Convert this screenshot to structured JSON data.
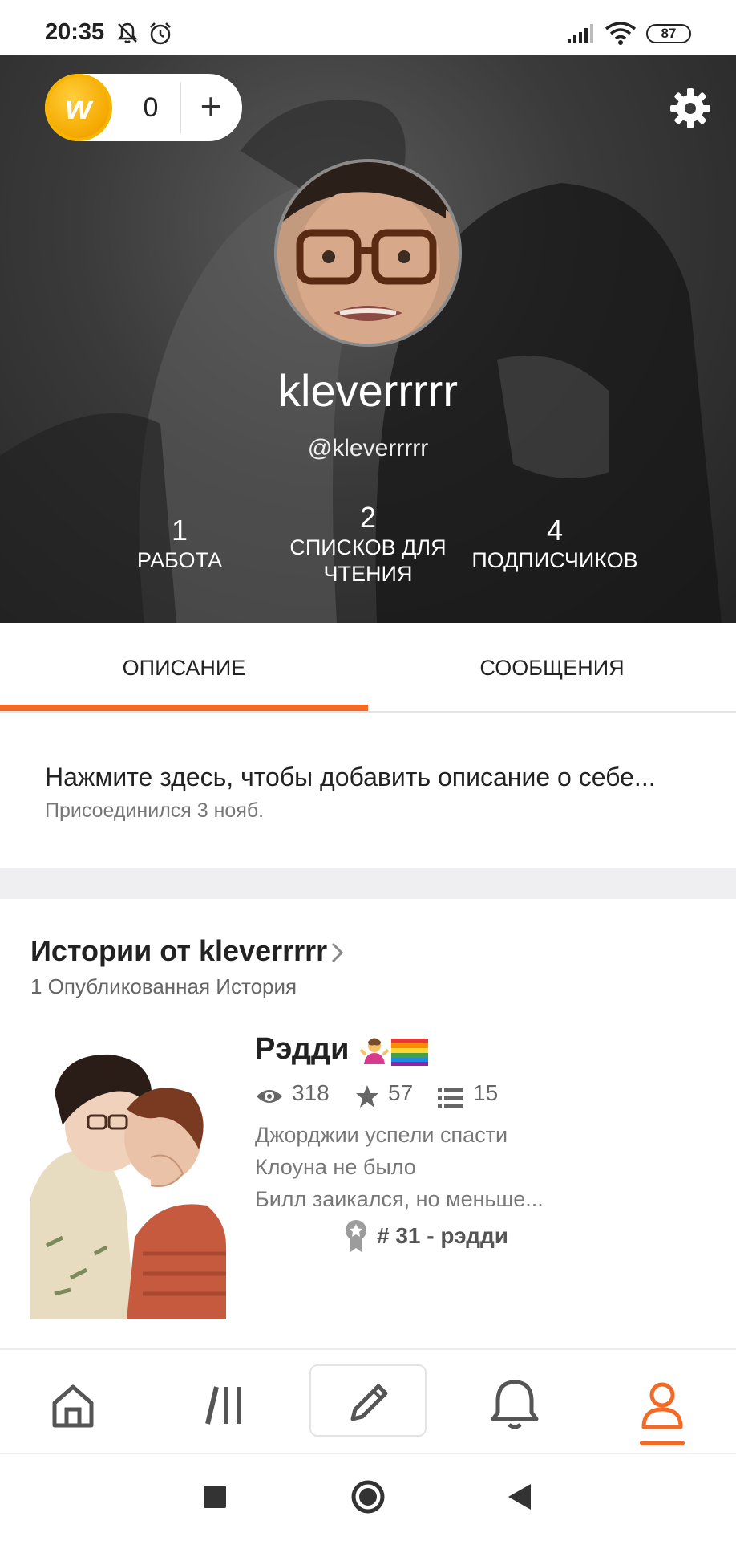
{
  "status_bar": {
    "time": "20:35",
    "battery": "87",
    "icons": [
      "bell-off-icon",
      "alarm-icon",
      "signal-icon",
      "wifi-icon",
      "battery-icon"
    ]
  },
  "header": {
    "coins": {
      "icon": "wattpad-coin-icon",
      "letter": "w",
      "count": "0",
      "add_label": "+"
    },
    "settings_icon": "gear-icon",
    "display_name": "kleverrrrr",
    "username": "@kleverrrrr",
    "stats": [
      {
        "value": "1",
        "label_lines": [
          "РАБОТА"
        ]
      },
      {
        "value": "2",
        "label_lines": [
          "СПИСКОВ ДЛЯ",
          "ЧТЕНИЯ"
        ]
      },
      {
        "value": "4",
        "label_lines": [
          "ПОДПИСЧИКОВ"
        ]
      }
    ]
  },
  "tabs": [
    {
      "label": "ОПИСАНИЕ",
      "active": true
    },
    {
      "label": "СООБЩЕНИЯ",
      "active": false
    }
  ],
  "about": {
    "prompt": "Нажмите здесь, чтобы добавить описание о себе...",
    "joined": "Присоединился 3 нояб."
  },
  "stories": {
    "title": "Истории от kleverrrrr",
    "count_label": "1 Опубликованная История",
    "items": [
      {
        "title": "Рэдди",
        "title_emoji": [
          "person-shrugging-emoji",
          "rainbow-flag-emoji"
        ],
        "reads": "318",
        "votes": "57",
        "parts": "15",
        "description_lines": [
          "Джорджии успели спасти",
          "Клоуна не было",
          "Билл заикался, но меньше..."
        ],
        "tag": "# 31 - рэдди"
      }
    ]
  },
  "bottom_nav": {
    "items": [
      "home-icon",
      "library-icon",
      "pencil-icon",
      "bell-icon",
      "profile-icon"
    ],
    "active": "profile-icon",
    "accent": "#f26a26"
  },
  "android_nav": [
    "recent-apps-icon",
    "home-circle-icon",
    "back-icon"
  ]
}
